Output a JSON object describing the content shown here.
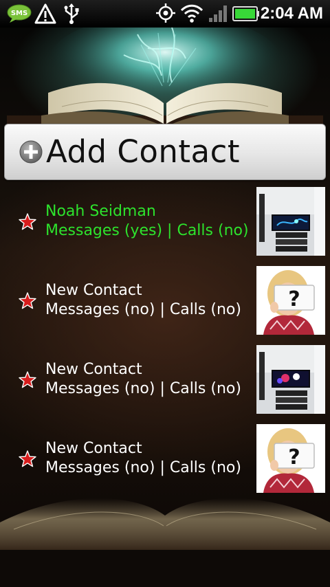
{
  "status_bar": {
    "time": "2:04 AM",
    "sms_icon_text": "SMS",
    "icons": [
      "sms-icon",
      "warning-icon",
      "usb-icon",
      "gps-icon",
      "wifi-icon",
      "signal-icon",
      "battery-icon"
    ]
  },
  "add_contact": {
    "label": "Add Contact",
    "icon": "plus-circle-icon"
  },
  "contacts": [
    {
      "name": "Noah Seidman",
      "status": "Messages (yes) | Calls (no)",
      "photo": "tv-photo",
      "active": true
    },
    {
      "name": "New Contact",
      "status": "Messages (no) | Calls (no)",
      "photo": "question-card-photo",
      "active": false
    },
    {
      "name": "New Contact",
      "status": "Messages (no) | Calls (no)",
      "photo": "tv-photo",
      "active": false
    },
    {
      "name": "New Contact",
      "status": "Messages (no) | Calls (no)",
      "photo": "question-card-photo",
      "active": false
    }
  ],
  "colors": {
    "active_text": "#2de32d",
    "inactive_text": "#ffffff",
    "star": "#d71c1c",
    "battery": "#38d838"
  }
}
